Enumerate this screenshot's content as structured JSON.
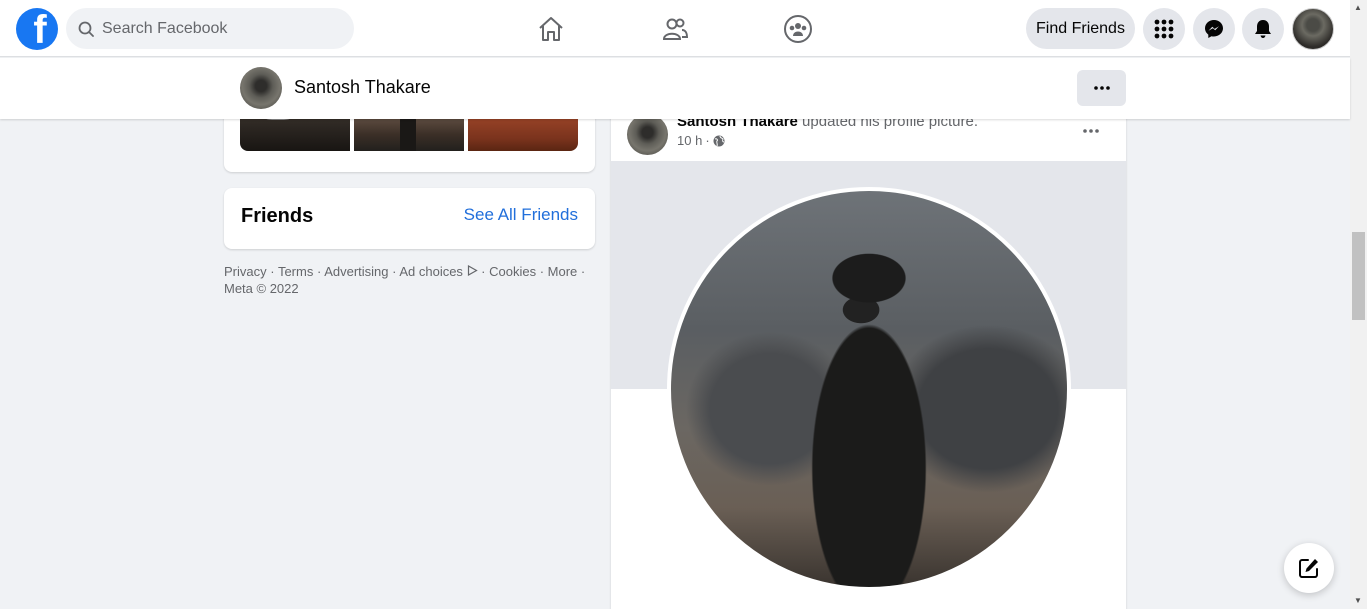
{
  "topnav": {
    "logo": "f",
    "search_placeholder": "Search Facebook",
    "find_friends_label": "Find Friends",
    "icons": [
      "home-icon",
      "friends-icon",
      "groups-icon",
      "menu-grid-icon",
      "messenger-icon",
      "notifications-icon",
      "account-avatar"
    ]
  },
  "profile_header": {
    "name": "Santosh Thakare"
  },
  "friends_card": {
    "title": "Friends",
    "see_all": "See All Friends"
  },
  "footer": {
    "links": [
      "Privacy",
      "Terms",
      "Advertising",
      "Ad choices",
      "Cookies",
      "More"
    ],
    "copyright": "Meta © 2022"
  },
  "post": {
    "author": "Santosh Thakare",
    "action": "updated his profile picture.",
    "time": "10 h",
    "privacy_icon": "globe-icon"
  },
  "colors": {
    "brand": "#1877f2",
    "link": "#216fdb",
    "background": "#f0f2f5"
  }
}
